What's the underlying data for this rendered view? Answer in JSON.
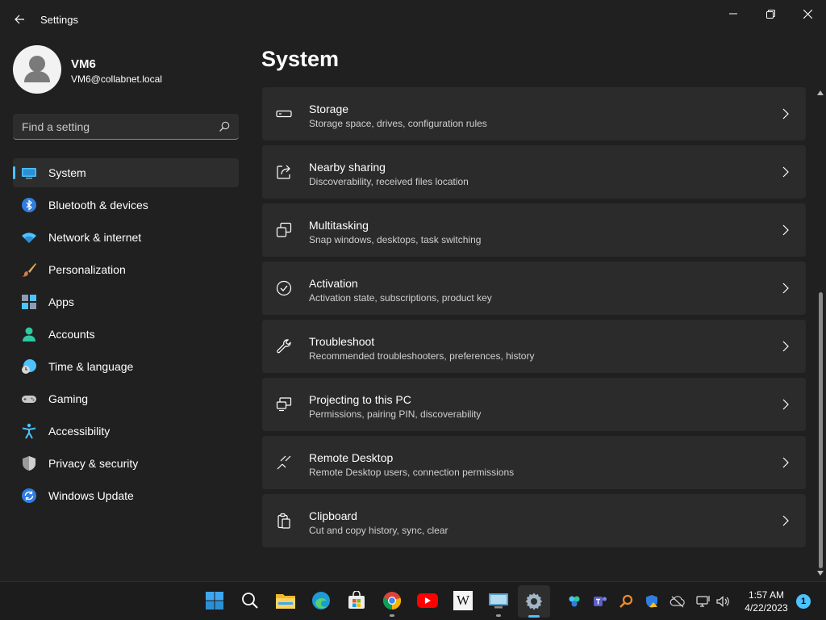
{
  "app": {
    "title": "Settings"
  },
  "profile": {
    "name": "VM6",
    "email": "VM6@collabnet.local"
  },
  "search": {
    "placeholder": "Find a setting"
  },
  "nav": {
    "items": [
      {
        "label": "System",
        "icon": "system-icon",
        "active": true
      },
      {
        "label": "Bluetooth & devices",
        "icon": "bluetooth-icon"
      },
      {
        "label": "Network & internet",
        "icon": "wifi-icon"
      },
      {
        "label": "Personalization",
        "icon": "brush-icon"
      },
      {
        "label": "Apps",
        "icon": "apps-icon"
      },
      {
        "label": "Accounts",
        "icon": "accounts-icon"
      },
      {
        "label": "Time & language",
        "icon": "time-language-icon"
      },
      {
        "label": "Gaming",
        "icon": "gamepad-icon"
      },
      {
        "label": "Accessibility",
        "icon": "accessibility-icon"
      },
      {
        "label": "Privacy & security",
        "icon": "shield-icon"
      },
      {
        "label": "Windows Update",
        "icon": "windows-update-icon"
      }
    ]
  },
  "main": {
    "title": "System",
    "cards": [
      {
        "title": "Storage",
        "desc": "Storage space, drives, configuration rules",
        "icon": "storage-icon"
      },
      {
        "title": "Nearby sharing",
        "desc": "Discoverability, received files location",
        "icon": "share-icon"
      },
      {
        "title": "Multitasking",
        "desc": "Snap windows, desktops, task switching",
        "icon": "multitasking-icon"
      },
      {
        "title": "Activation",
        "desc": "Activation state, subscriptions, product key",
        "icon": "activation-icon"
      },
      {
        "title": "Troubleshoot",
        "desc": "Recommended troubleshooters, preferences, history",
        "icon": "wrench-icon"
      },
      {
        "title": "Projecting to this PC",
        "desc": "Permissions, pairing PIN, discoverability",
        "icon": "projecting-icon"
      },
      {
        "title": "Remote Desktop",
        "desc": "Remote Desktop users, connection permissions",
        "icon": "remote-desktop-icon"
      },
      {
        "title": "Clipboard",
        "desc": "Cut and copy history, sync, clear",
        "icon": "clipboard-icon"
      }
    ]
  },
  "taskbar": {
    "time": "1:57 AM",
    "date": "4/22/2023",
    "notification_count": "1",
    "wiki_letter": "W"
  },
  "colors": {
    "accent": "#4cc2ff",
    "background": "#202020",
    "card": "#2b2b2b"
  }
}
